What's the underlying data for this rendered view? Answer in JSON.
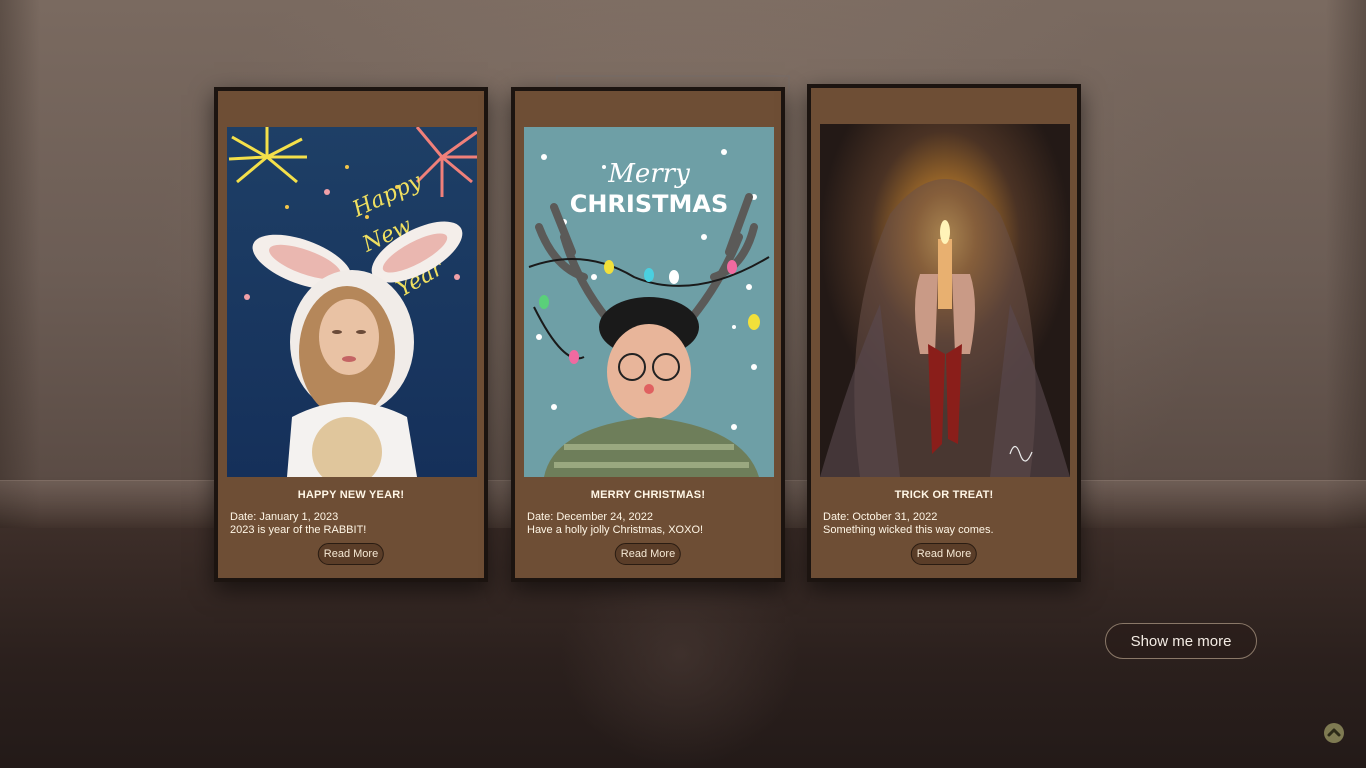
{
  "gallery": {
    "cards": [
      {
        "title": "HAPPY NEW YEAR!",
        "date": "Date: January 1, 2023",
        "description": "2023 is year of the RABBIT!",
        "read_more": "Read More",
        "art_text": [
          "Happy",
          "New",
          "Year"
        ]
      },
      {
        "title": "MERRY CHRISTMAS!",
        "date": "Date: December 24, 2022",
        "description": "Have a holly jolly Christmas, XOXO!",
        "read_more": "Read More",
        "art_text": [
          "Merry",
          "CHRISTMAS"
        ]
      },
      {
        "title": "TRICK OR TREAT!",
        "date": "Date: October 31, 2022",
        "description": "Something wicked this way comes.",
        "read_more": "Read More"
      }
    ]
  },
  "show_more_label": "Show me more",
  "icons": {
    "scroll_top": "chevron-up-circle-icon"
  },
  "colors": {
    "card_bg": "#6e4e35",
    "card_border": "#1c1410",
    "text": "#fff6e6",
    "scroll_button": "#7e7a52"
  }
}
